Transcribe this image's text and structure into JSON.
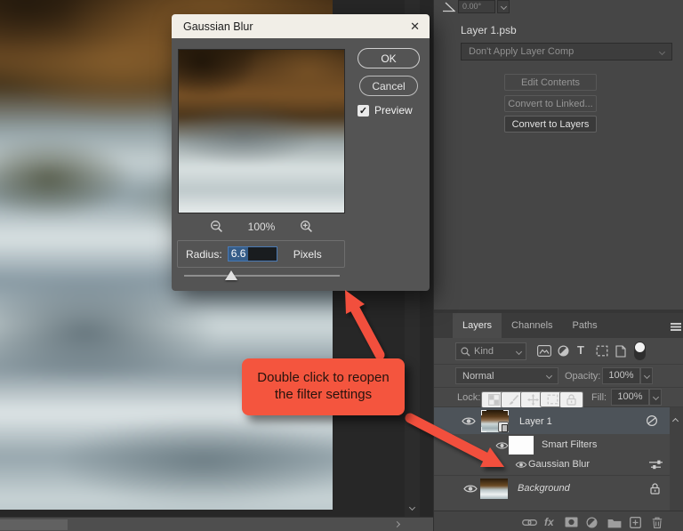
{
  "dialog": {
    "title": "Gaussian Blur",
    "close_icon": "✕",
    "ok_label": "OK",
    "cancel_label": "Cancel",
    "preview_label": "Preview",
    "checkmark": "✓",
    "zoom_level": "100%",
    "radius_label": "Radius:",
    "radius_value": "6.6",
    "radius_unit": "Pixels"
  },
  "properties_panel": {
    "angle_value": "0.00°",
    "doc_name": "Layer 1.psb",
    "layer_comp_value": "Don't Apply Layer Comp",
    "buttons": [
      "Edit Contents",
      "Convert to Linked...",
      "Convert to Layers"
    ]
  },
  "layers_panel": {
    "tabs": [
      "Layers",
      "Channels",
      "Paths"
    ],
    "kind_filter_label": "Kind",
    "type_icon_label": "T",
    "blend_mode_value": "Normal",
    "opacity_label": "Opacity:",
    "opacity_value": "100%",
    "lock_label": "Lock:",
    "fill_label": "Fill:",
    "fill_value": "100%",
    "fx_icon_label": "fx",
    "layers": [
      {
        "name": "Layer 1",
        "selected": true
      },
      {
        "name": "Smart Filters"
      },
      {
        "name": "Gaussian Blur"
      },
      {
        "name": "Background",
        "locked": true
      }
    ]
  },
  "annotation": {
    "line1": "Double click to reopen",
    "line2": "the filter settings"
  },
  "colors": {
    "annotation_red": "#f4553e",
    "selection_blue": "#355c88",
    "dialog_titlebar": "#f1eee7"
  }
}
